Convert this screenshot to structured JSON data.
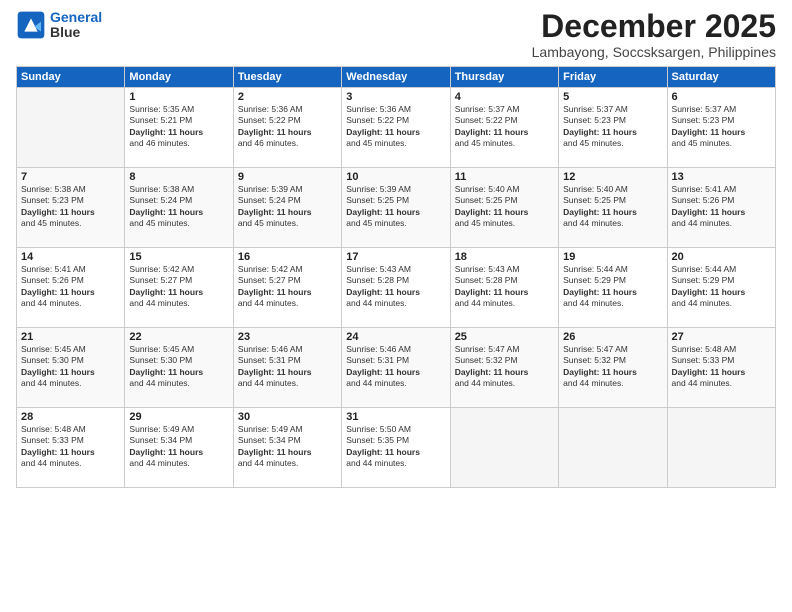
{
  "logo": {
    "line1": "General",
    "line2": "Blue"
  },
  "title": "December 2025",
  "location": "Lambayong, Soccsksargen, Philippines",
  "weekdays": [
    "Sunday",
    "Monday",
    "Tuesday",
    "Wednesday",
    "Thursday",
    "Friday",
    "Saturday"
  ],
  "weeks": [
    [
      {
        "day": "",
        "text": ""
      },
      {
        "day": "1",
        "text": "Sunrise: 5:35 AM\nSunset: 5:21 PM\nDaylight: 11 hours\nand 46 minutes."
      },
      {
        "day": "2",
        "text": "Sunrise: 5:36 AM\nSunset: 5:22 PM\nDaylight: 11 hours\nand 46 minutes."
      },
      {
        "day": "3",
        "text": "Sunrise: 5:36 AM\nSunset: 5:22 PM\nDaylight: 11 hours\nand 45 minutes."
      },
      {
        "day": "4",
        "text": "Sunrise: 5:37 AM\nSunset: 5:22 PM\nDaylight: 11 hours\nand 45 minutes."
      },
      {
        "day": "5",
        "text": "Sunrise: 5:37 AM\nSunset: 5:23 PM\nDaylight: 11 hours\nand 45 minutes."
      },
      {
        "day": "6",
        "text": "Sunrise: 5:37 AM\nSunset: 5:23 PM\nDaylight: 11 hours\nand 45 minutes."
      }
    ],
    [
      {
        "day": "7",
        "text": "Sunrise: 5:38 AM\nSunset: 5:23 PM\nDaylight: 11 hours\nand 45 minutes."
      },
      {
        "day": "8",
        "text": "Sunrise: 5:38 AM\nSunset: 5:24 PM\nDaylight: 11 hours\nand 45 minutes."
      },
      {
        "day": "9",
        "text": "Sunrise: 5:39 AM\nSunset: 5:24 PM\nDaylight: 11 hours\nand 45 minutes."
      },
      {
        "day": "10",
        "text": "Sunrise: 5:39 AM\nSunset: 5:25 PM\nDaylight: 11 hours\nand 45 minutes."
      },
      {
        "day": "11",
        "text": "Sunrise: 5:40 AM\nSunset: 5:25 PM\nDaylight: 11 hours\nand 45 minutes."
      },
      {
        "day": "12",
        "text": "Sunrise: 5:40 AM\nSunset: 5:25 PM\nDaylight: 11 hours\nand 44 minutes."
      },
      {
        "day": "13",
        "text": "Sunrise: 5:41 AM\nSunset: 5:26 PM\nDaylight: 11 hours\nand 44 minutes."
      }
    ],
    [
      {
        "day": "14",
        "text": "Sunrise: 5:41 AM\nSunset: 5:26 PM\nDaylight: 11 hours\nand 44 minutes."
      },
      {
        "day": "15",
        "text": "Sunrise: 5:42 AM\nSunset: 5:27 PM\nDaylight: 11 hours\nand 44 minutes."
      },
      {
        "day": "16",
        "text": "Sunrise: 5:42 AM\nSunset: 5:27 PM\nDaylight: 11 hours\nand 44 minutes."
      },
      {
        "day": "17",
        "text": "Sunrise: 5:43 AM\nSunset: 5:28 PM\nDaylight: 11 hours\nand 44 minutes."
      },
      {
        "day": "18",
        "text": "Sunrise: 5:43 AM\nSunset: 5:28 PM\nDaylight: 11 hours\nand 44 minutes."
      },
      {
        "day": "19",
        "text": "Sunrise: 5:44 AM\nSunset: 5:29 PM\nDaylight: 11 hours\nand 44 minutes."
      },
      {
        "day": "20",
        "text": "Sunrise: 5:44 AM\nSunset: 5:29 PM\nDaylight: 11 hours\nand 44 minutes."
      }
    ],
    [
      {
        "day": "21",
        "text": "Sunrise: 5:45 AM\nSunset: 5:30 PM\nDaylight: 11 hours\nand 44 minutes."
      },
      {
        "day": "22",
        "text": "Sunrise: 5:45 AM\nSunset: 5:30 PM\nDaylight: 11 hours\nand 44 minutes."
      },
      {
        "day": "23",
        "text": "Sunrise: 5:46 AM\nSunset: 5:31 PM\nDaylight: 11 hours\nand 44 minutes."
      },
      {
        "day": "24",
        "text": "Sunrise: 5:46 AM\nSunset: 5:31 PM\nDaylight: 11 hours\nand 44 minutes."
      },
      {
        "day": "25",
        "text": "Sunrise: 5:47 AM\nSunset: 5:32 PM\nDaylight: 11 hours\nand 44 minutes."
      },
      {
        "day": "26",
        "text": "Sunrise: 5:47 AM\nSunset: 5:32 PM\nDaylight: 11 hours\nand 44 minutes."
      },
      {
        "day": "27",
        "text": "Sunrise: 5:48 AM\nSunset: 5:33 PM\nDaylight: 11 hours\nand 44 minutes."
      }
    ],
    [
      {
        "day": "28",
        "text": "Sunrise: 5:48 AM\nSunset: 5:33 PM\nDaylight: 11 hours\nand 44 minutes."
      },
      {
        "day": "29",
        "text": "Sunrise: 5:49 AM\nSunset: 5:34 PM\nDaylight: 11 hours\nand 44 minutes."
      },
      {
        "day": "30",
        "text": "Sunrise: 5:49 AM\nSunset: 5:34 PM\nDaylight: 11 hours\nand 44 minutes."
      },
      {
        "day": "31",
        "text": "Sunrise: 5:50 AM\nSunset: 5:35 PM\nDaylight: 11 hours\nand 44 minutes."
      },
      {
        "day": "",
        "text": ""
      },
      {
        "day": "",
        "text": ""
      },
      {
        "day": "",
        "text": ""
      }
    ]
  ]
}
